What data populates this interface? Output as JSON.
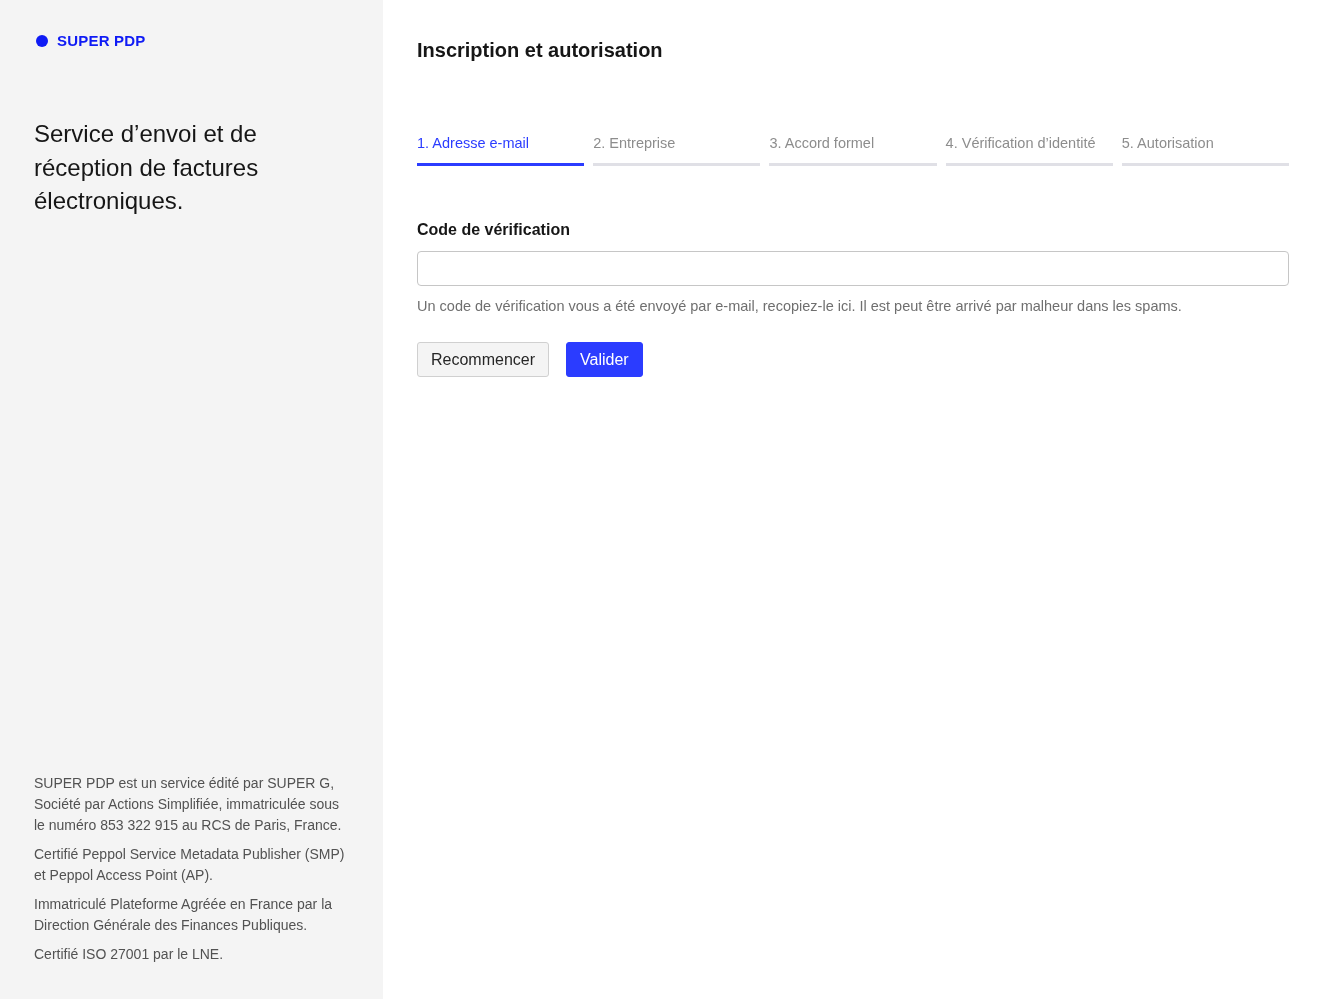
{
  "sidebar": {
    "brand": "SUPER PDP",
    "tagline": "Service d’envoi et de réception de factures électroniques.",
    "legal": [
      "SUPER PDP est un service édité par SUPER G, Société par Actions Simplifiée, immatriculée sous le numéro 853 322 915 au RCS de Paris, France.",
      "Certifié Peppol Service Metadata Publisher (SMP) et Peppol Access Point (AP).",
      "Immatriculé Plateforme Agréée en France par la Direction Générale des Finances Publiques.",
      "Certifié ISO 27001 par le LNE."
    ]
  },
  "main": {
    "title": "Inscription et autorisation",
    "steps": [
      {
        "label": "1. Adresse e-mail",
        "selected": true
      },
      {
        "label": "2. Entreprise",
        "selected": false
      },
      {
        "label": "3. Accord formel",
        "selected": false
      },
      {
        "label": "4. Vérification d’identité",
        "selected": false
      },
      {
        "label": "5. Autorisation",
        "selected": false
      }
    ],
    "field": {
      "label": "Code de vérification",
      "help": "Un code de vérification vous a été envoyé par e-mail, recopiez-le ici. Il est peut être arrivé par malheur dans les spams."
    },
    "buttons": [
      {
        "label": "Recommencer",
        "kind": "secondary"
      },
      {
        "label": "Valider",
        "kind": "primary"
      }
    ]
  }
}
